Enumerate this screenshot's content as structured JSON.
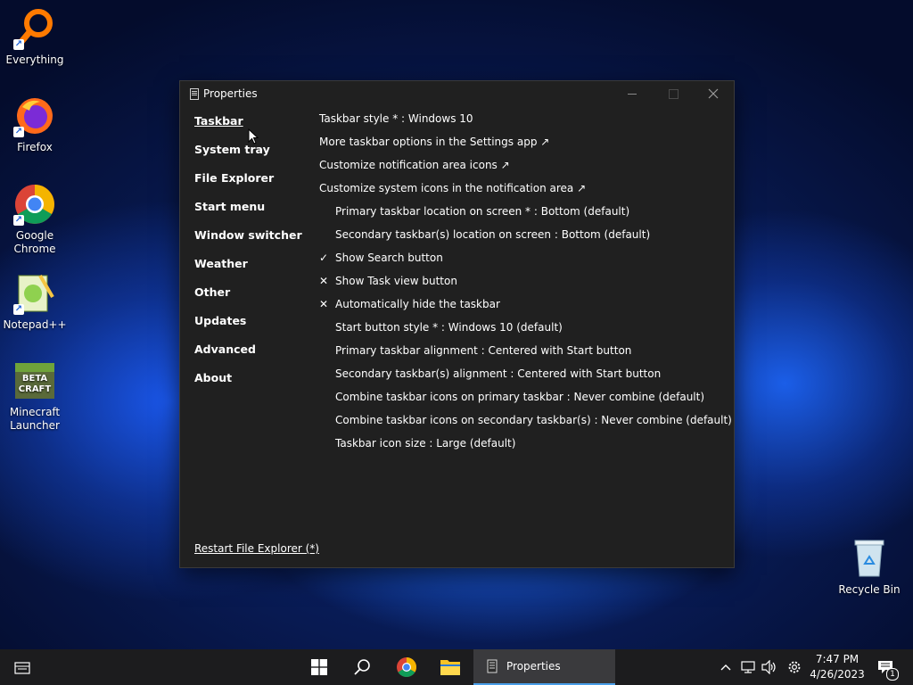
{
  "desktop": {
    "icons": [
      {
        "label": "Everything"
      },
      {
        "label": "Firefox"
      },
      {
        "label": "Google Chrome"
      },
      {
        "label": "Notepad++"
      },
      {
        "label": "Minecraft Launcher"
      },
      {
        "label": "Recycle Bin"
      }
    ]
  },
  "window": {
    "title": "Properties",
    "nav": [
      {
        "label": "Taskbar",
        "active": true
      },
      {
        "label": "System tray"
      },
      {
        "label": "File Explorer"
      },
      {
        "label": "Start menu"
      },
      {
        "label": "Window switcher"
      },
      {
        "label": "Weather"
      },
      {
        "label": "Other"
      },
      {
        "label": "Updates"
      },
      {
        "label": "Advanced"
      },
      {
        "label": "About"
      }
    ],
    "restart_link": "Restart File Explorer (*)",
    "settings": [
      {
        "text": "Taskbar style * : Windows 10",
        "indent": false
      },
      {
        "text": "More taskbar options in the Settings app ↗",
        "indent": false
      },
      {
        "text": "Customize notification area icons ↗",
        "indent": false
      },
      {
        "text": "Customize system icons in the notification area ↗",
        "indent": false
      },
      {
        "text": "Primary taskbar location on screen * : Bottom (default)",
        "indent": true
      },
      {
        "text": "Secondary taskbar(s) location on screen : Bottom (default)",
        "indent": true
      },
      {
        "text": "Show Search button",
        "indent": true,
        "mark": "✓"
      },
      {
        "text": "Show Task view button",
        "indent": true,
        "mark": "✕"
      },
      {
        "text": "Automatically hide the taskbar",
        "indent": true,
        "mark": "✕"
      },
      {
        "text": "Start button style * : Windows 10 (default)",
        "indent": true
      },
      {
        "text": "Primary taskbar alignment : Centered with Start button",
        "indent": true
      },
      {
        "text": "Secondary taskbar(s) alignment : Centered with Start button",
        "indent": true
      },
      {
        "text": "Combine taskbar icons on primary taskbar : Never combine (default)",
        "indent": true
      },
      {
        "text": "Combine taskbar icons on secondary taskbar(s) : Never combine (default)",
        "indent": true
      },
      {
        "text": "Taskbar icon size : Large (default)",
        "indent": true
      }
    ]
  },
  "taskbar": {
    "active_app_label": "Properties",
    "time": "7:47 PM",
    "date": "4/26/2023",
    "notification_count": "1"
  },
  "colors": {
    "window_bg": "#202020",
    "taskbar_bg": "#1c1c1e",
    "accent": "#4a9ee8"
  }
}
